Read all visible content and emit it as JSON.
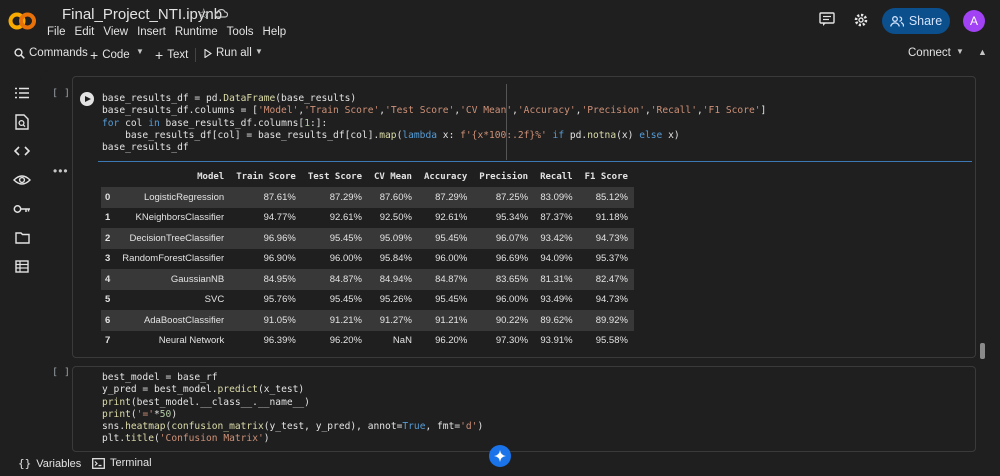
{
  "header": {
    "title": "Final_Project_NTI.ipynb",
    "menu": [
      "File",
      "Edit",
      "View",
      "Insert",
      "Runtime",
      "Tools",
      "Help"
    ],
    "share_label": "Share",
    "avatar_initial": "A",
    "brand_color": "#f9ab00"
  },
  "toolbar": {
    "commands_label": "Commands",
    "code_label": "Code",
    "text_label": "Text",
    "run_all_label": "Run all",
    "connect_label": "Connect"
  },
  "cell1": {
    "bracket": "[ ]",
    "output_marker": "•••",
    "table": {
      "columns": [
        "",
        "Model",
        "Train Score",
        "Test Score",
        "CV Mean",
        "Accuracy",
        "Precision",
        "Recall",
        "F1 Score"
      ],
      "rows": [
        [
          "0",
          "LogisticRegression",
          "87.61%",
          "87.29%",
          "87.60%",
          "87.29%",
          "87.25%",
          "83.09%",
          "85.12%"
        ],
        [
          "1",
          "KNeighborsClassifier",
          "94.77%",
          "92.61%",
          "92.50%",
          "92.61%",
          "95.34%",
          "87.37%",
          "91.18%"
        ],
        [
          "2",
          "DecisionTreeClassifier",
          "96.96%",
          "95.45%",
          "95.09%",
          "95.45%",
          "96.07%",
          "93.42%",
          "94.73%"
        ],
        [
          "3",
          "RandomForestClassifier",
          "96.90%",
          "96.00%",
          "95.84%",
          "96.00%",
          "96.69%",
          "94.09%",
          "95.37%"
        ],
        [
          "4",
          "GaussianNB",
          "84.95%",
          "84.87%",
          "84.94%",
          "84.87%",
          "83.65%",
          "81.31%",
          "82.47%"
        ],
        [
          "5",
          "SVC",
          "95.76%",
          "95.45%",
          "95.26%",
          "95.45%",
          "96.00%",
          "93.49%",
          "94.73%"
        ],
        [
          "6",
          "AdaBoostClassifier",
          "91.05%",
          "91.21%",
          "91.27%",
          "91.21%",
          "90.22%",
          "89.62%",
          "89.92%"
        ],
        [
          "7",
          "Neural Network",
          "96.39%",
          "96.20%",
          "NaN",
          "96.20%",
          "97.30%",
          "93.91%",
          "95.58%"
        ]
      ]
    }
  },
  "cell2": {
    "bracket": "[ ]"
  },
  "footer": {
    "variables_label": "Variables",
    "terminal_label": "Terminal"
  }
}
